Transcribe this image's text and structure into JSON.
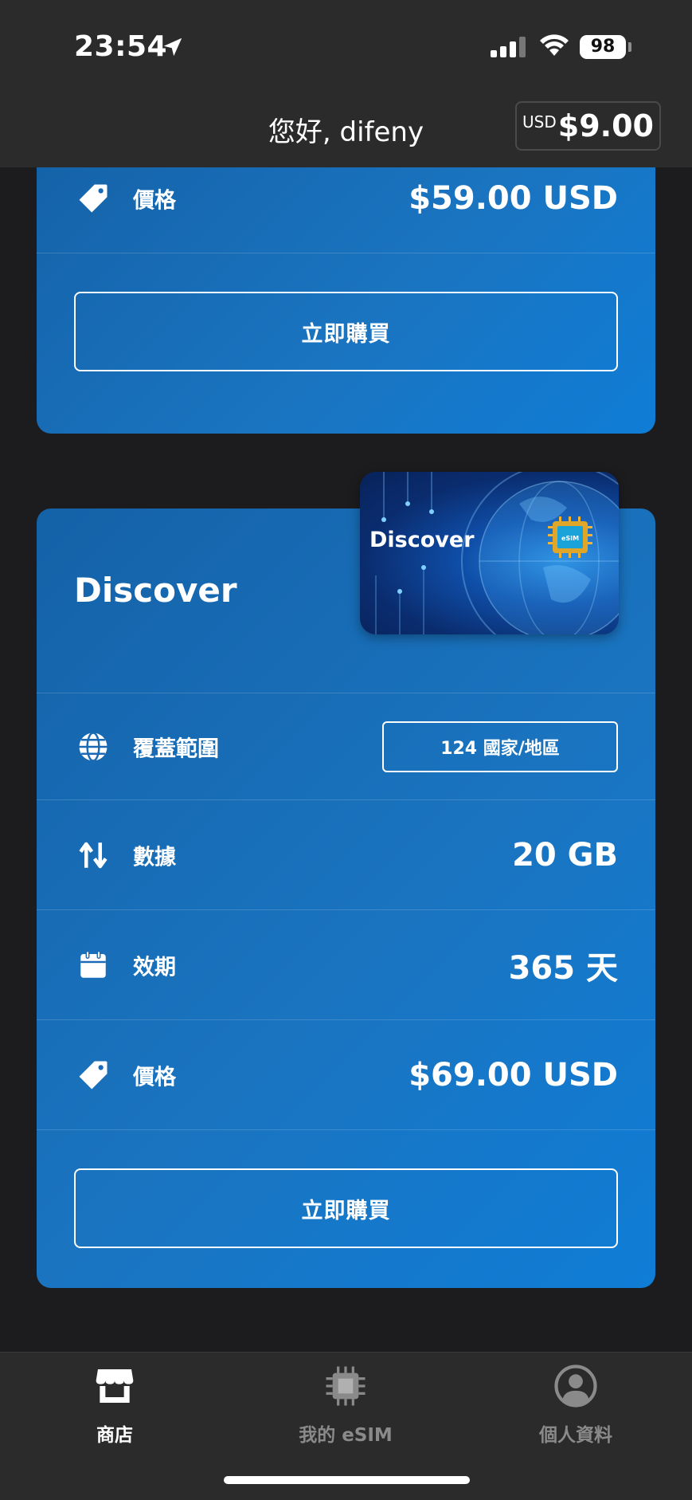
{
  "status_bar": {
    "time": "23:54",
    "battery": "98"
  },
  "header": {
    "greeting": "您好, difeny",
    "balance_currency": "USD",
    "balance_amount": "$9.00"
  },
  "plans": [
    {
      "price_label": "價格",
      "price_value": "$59.00 USD",
      "buy_label": "立即購買"
    },
    {
      "name": "Discover",
      "card_art_label": "Discover",
      "coverage_label": "覆蓋範圍",
      "coverage_value": "124 國家/地區",
      "data_label": "數據",
      "data_value": "20 GB",
      "validity_label": "效期",
      "validity_value": "365 天",
      "price_label": "價格",
      "price_value": "$69.00 USD",
      "buy_label": "立即購買"
    }
  ],
  "tabs": [
    {
      "label": "商店",
      "icon": "store-icon",
      "active": true
    },
    {
      "label": "我的 eSIM",
      "icon": "chip-icon",
      "active": false
    },
    {
      "label": "個人資料",
      "icon": "profile-icon",
      "active": false
    }
  ],
  "colors": {
    "card_blue": "#1a74c0",
    "background": "#1c1c1e",
    "bar": "#2b2b2b"
  }
}
